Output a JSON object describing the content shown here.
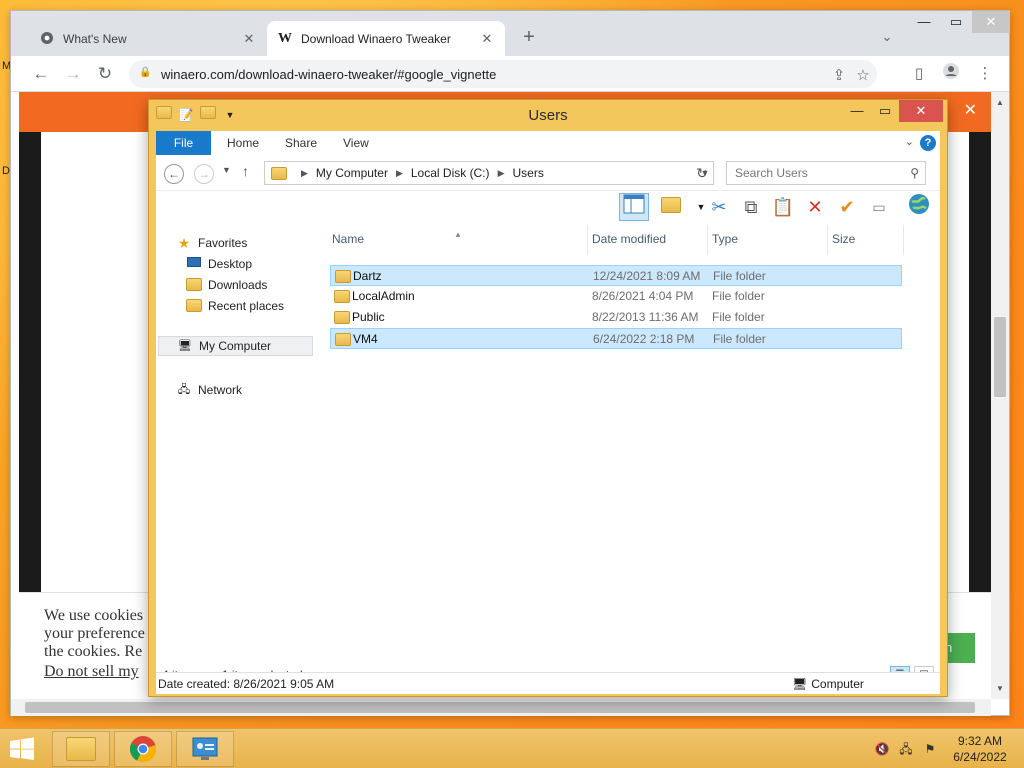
{
  "browser": {
    "tabs": [
      {
        "title": "What's New",
        "icon": "chrome-icon",
        "active": false
      },
      {
        "title": "Download Winaero Tweaker",
        "icon": "winaero-w-icon",
        "active": true
      }
    ],
    "url": "winaero.com/download-winaero-tweaker/#google_vignette",
    "tab_close_glyph": "✕",
    "new_tab_glyph": "+",
    "tab_search_glyph": "⌄"
  },
  "page": {
    "cookie_lines": [
      "We use cookies",
      "your preference",
      "the cookies. Re"
    ],
    "cookie_link": "Do not sell my",
    "cookie_button": "n",
    "banner_close": "✕"
  },
  "desktop": {
    "fragment_top": "M",
    "fragment_mid": "D"
  },
  "explorer": {
    "title": "Users",
    "ribbon_tabs": [
      "File",
      "Home",
      "Share",
      "View"
    ],
    "breadcrumb": [
      "My Computer",
      "Local Disk (C:)",
      "Users"
    ],
    "search_placeholder": "Search Users",
    "nav": {
      "favorites_label": "Favorites",
      "favorites": [
        "Desktop",
        "Downloads",
        "Recent places"
      ],
      "computer": "My Computer",
      "network": "Network"
    },
    "columns": [
      "Name",
      "Date modified",
      "Type",
      "Size"
    ],
    "rows": [
      {
        "name": "Dartz",
        "date": "12/24/2021 8:09 AM",
        "type": "File folder",
        "selected": true
      },
      {
        "name": "LocalAdmin",
        "date": "8/26/2021 4:04 PM",
        "type": "File folder",
        "selected": false
      },
      {
        "name": "Public",
        "date": "8/22/2013 11:36 AM",
        "type": "File folder",
        "selected": false
      },
      {
        "name": "VM4",
        "date": "6/24/2022 2:18 PM",
        "type": "File folder",
        "selected": true
      }
    ],
    "status": {
      "count": "4 items",
      "selection": "1 item selected"
    },
    "details": {
      "text": "Date created: 8/26/2021 9:05 AM",
      "location": "Computer"
    }
  },
  "taskbar": {
    "time": "9:32 AM",
    "date": "6/24/2022"
  },
  "colors": {
    "explorer_frame": "#f3c75c",
    "file_tab": "#1979ca",
    "selection": "#cce8ff",
    "orange_header": "#f26a21",
    "close_red": "#d9534f"
  }
}
